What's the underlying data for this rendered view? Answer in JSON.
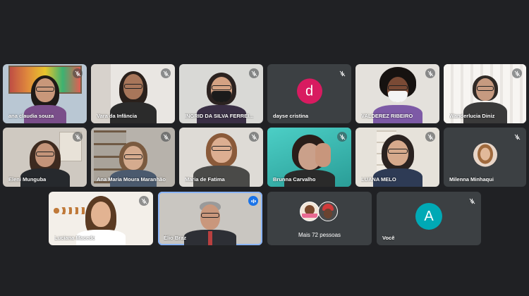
{
  "participants": [
    {
      "name": "ana claudia souza",
      "muted": true
    },
    {
      "name": "Vara da Infância",
      "muted": true
    },
    {
      "name": "INGRID DA SILVA FERREI...",
      "muted": true
    },
    {
      "name": "dayse cristina",
      "muted": true,
      "initial": "d",
      "avatar_color": "#d81b60"
    },
    {
      "name": "VALDEREZ RIBEIRO",
      "muted": true
    },
    {
      "name": "Wanderlucia Diniz",
      "muted": true
    },
    {
      "name": "Eleni Munguba",
      "muted": true
    },
    {
      "name": "Ana Maria Moura Maranhão",
      "muted": true
    },
    {
      "name": "Maria de Fatima",
      "muted": true
    },
    {
      "name": "Brunna Carvalho",
      "muted": true
    },
    {
      "name": "LUANA MELO",
      "muted": true
    },
    {
      "name": "Milenna Minhaqui",
      "muted": true
    },
    {
      "name": "Luciana Macedo",
      "muted": true
    },
    {
      "name": "Élio Braz",
      "muted": false,
      "speaking": true
    },
    {
      "name": "Você",
      "muted": true,
      "initial": "A",
      "avatar_color": "#00a9b5"
    }
  ],
  "more": {
    "label": "Mais 72 pessoas"
  },
  "colors": {
    "background": "#202124",
    "tile": "#3c4043",
    "speaking_outline": "#8ab4f8"
  },
  "icons": {
    "muted": "mic-off-icon",
    "active": "audio-level-icon"
  }
}
